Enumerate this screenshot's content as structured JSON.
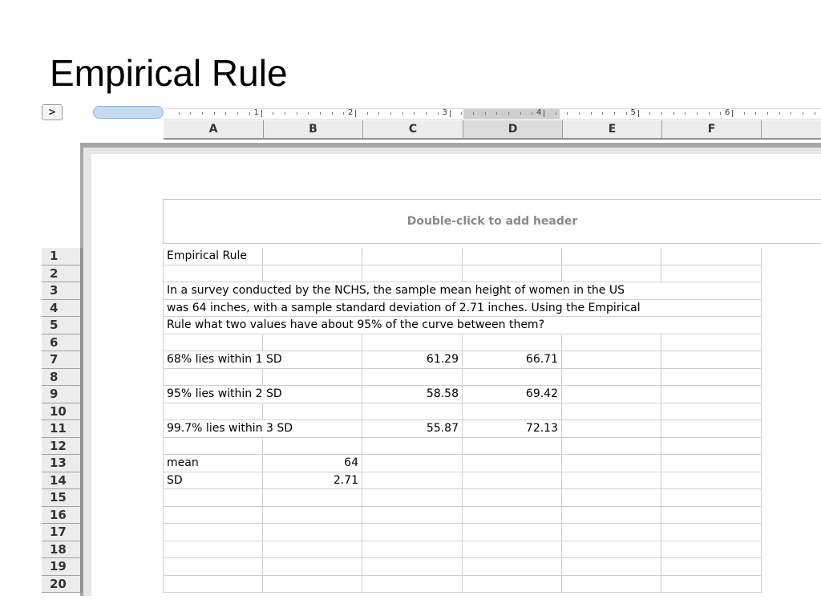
{
  "slide": {
    "title": "Empirical Rule"
  },
  "toolbar": {
    "corner_glyph": ">"
  },
  "ruler": {
    "labels": [
      "1",
      "2",
      "3",
      "4",
      "5",
      "6"
    ]
  },
  "columns": [
    "A",
    "B",
    "C",
    "D",
    "E",
    "F"
  ],
  "active_column": "D",
  "page_header": {
    "placeholder": "Double-click to add header"
  },
  "rows": [
    "1",
    "2",
    "3",
    "4",
    "5",
    "6",
    "7",
    "8",
    "9",
    "10",
    "11",
    "12",
    "13",
    "14",
    "15",
    "16",
    "17",
    "18",
    "19",
    "20"
  ],
  "sheet": {
    "r1_a": "Empirical Rule",
    "r3_a": "In a survey conducted by the NCHS, the sample mean height of women in the US",
    "r4_a": "was 64 inches, with a sample standard deviation of 2.71 inches.  Using the Empirical",
    "r5_a": "Rule what two values have about 95% of the curve between them?",
    "r7_a": "68% lies within 1 SD",
    "r7_c": "61.29",
    "r7_d": "66.71",
    "r9_a": "95% lies within 2 SD",
    "r9_c": "58.58",
    "r9_d": "69.42",
    "r11_a": "99.7% lies within 3 SD",
    "r11_c": "55.87",
    "r11_d": "72.13",
    "r13_a": "mean",
    "r13_b": "64",
    "r14_a": "SD",
    "r14_b": "2.71"
  }
}
